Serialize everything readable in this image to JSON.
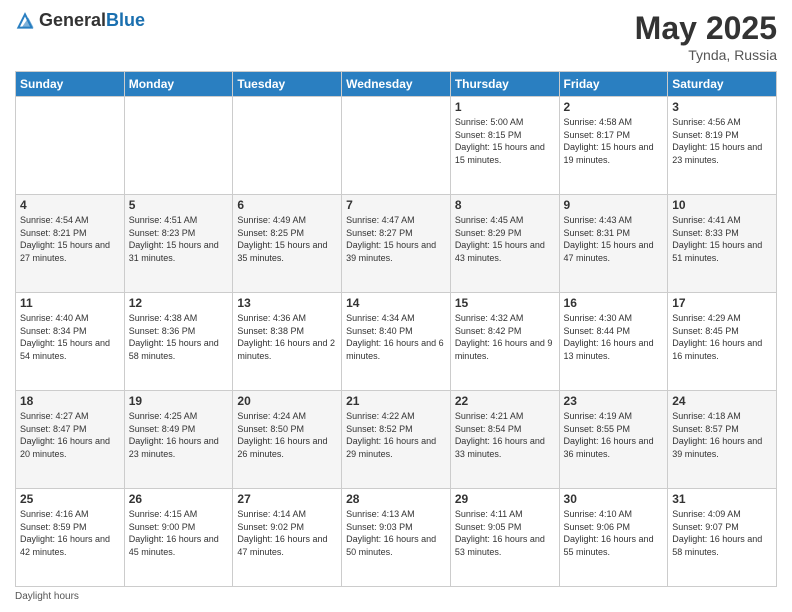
{
  "header": {
    "logo_general": "General",
    "logo_blue": "Blue",
    "month_year": "May 2025",
    "location": "Tynda, Russia"
  },
  "days_of_week": [
    "Sunday",
    "Monday",
    "Tuesday",
    "Wednesday",
    "Thursday",
    "Friday",
    "Saturday"
  ],
  "weeks": [
    [
      {
        "day": "",
        "sunrise": "",
        "sunset": "",
        "daylight": ""
      },
      {
        "day": "",
        "sunrise": "",
        "sunset": "",
        "daylight": ""
      },
      {
        "day": "",
        "sunrise": "",
        "sunset": "",
        "daylight": ""
      },
      {
        "day": "",
        "sunrise": "",
        "sunset": "",
        "daylight": ""
      },
      {
        "day": "1",
        "sunrise": "Sunrise: 5:00 AM",
        "sunset": "Sunset: 8:15 PM",
        "daylight": "Daylight: 15 hours and 15 minutes."
      },
      {
        "day": "2",
        "sunrise": "Sunrise: 4:58 AM",
        "sunset": "Sunset: 8:17 PM",
        "daylight": "Daylight: 15 hours and 19 minutes."
      },
      {
        "day": "3",
        "sunrise": "Sunrise: 4:56 AM",
        "sunset": "Sunset: 8:19 PM",
        "daylight": "Daylight: 15 hours and 23 minutes."
      }
    ],
    [
      {
        "day": "4",
        "sunrise": "Sunrise: 4:54 AM",
        "sunset": "Sunset: 8:21 PM",
        "daylight": "Daylight: 15 hours and 27 minutes."
      },
      {
        "day": "5",
        "sunrise": "Sunrise: 4:51 AM",
        "sunset": "Sunset: 8:23 PM",
        "daylight": "Daylight: 15 hours and 31 minutes."
      },
      {
        "day": "6",
        "sunrise": "Sunrise: 4:49 AM",
        "sunset": "Sunset: 8:25 PM",
        "daylight": "Daylight: 15 hours and 35 minutes."
      },
      {
        "day": "7",
        "sunrise": "Sunrise: 4:47 AM",
        "sunset": "Sunset: 8:27 PM",
        "daylight": "Daylight: 15 hours and 39 minutes."
      },
      {
        "day": "8",
        "sunrise": "Sunrise: 4:45 AM",
        "sunset": "Sunset: 8:29 PM",
        "daylight": "Daylight: 15 hours and 43 minutes."
      },
      {
        "day": "9",
        "sunrise": "Sunrise: 4:43 AM",
        "sunset": "Sunset: 8:31 PM",
        "daylight": "Daylight: 15 hours and 47 minutes."
      },
      {
        "day": "10",
        "sunrise": "Sunrise: 4:41 AM",
        "sunset": "Sunset: 8:33 PM",
        "daylight": "Daylight: 15 hours and 51 minutes."
      }
    ],
    [
      {
        "day": "11",
        "sunrise": "Sunrise: 4:40 AM",
        "sunset": "Sunset: 8:34 PM",
        "daylight": "Daylight: 15 hours and 54 minutes."
      },
      {
        "day": "12",
        "sunrise": "Sunrise: 4:38 AM",
        "sunset": "Sunset: 8:36 PM",
        "daylight": "Daylight: 15 hours and 58 minutes."
      },
      {
        "day": "13",
        "sunrise": "Sunrise: 4:36 AM",
        "sunset": "Sunset: 8:38 PM",
        "daylight": "Daylight: 16 hours and 2 minutes."
      },
      {
        "day": "14",
        "sunrise": "Sunrise: 4:34 AM",
        "sunset": "Sunset: 8:40 PM",
        "daylight": "Daylight: 16 hours and 6 minutes."
      },
      {
        "day": "15",
        "sunrise": "Sunrise: 4:32 AM",
        "sunset": "Sunset: 8:42 PM",
        "daylight": "Daylight: 16 hours and 9 minutes."
      },
      {
        "day": "16",
        "sunrise": "Sunrise: 4:30 AM",
        "sunset": "Sunset: 8:44 PM",
        "daylight": "Daylight: 16 hours and 13 minutes."
      },
      {
        "day": "17",
        "sunrise": "Sunrise: 4:29 AM",
        "sunset": "Sunset: 8:45 PM",
        "daylight": "Daylight: 16 hours and 16 minutes."
      }
    ],
    [
      {
        "day": "18",
        "sunrise": "Sunrise: 4:27 AM",
        "sunset": "Sunset: 8:47 PM",
        "daylight": "Daylight: 16 hours and 20 minutes."
      },
      {
        "day": "19",
        "sunrise": "Sunrise: 4:25 AM",
        "sunset": "Sunset: 8:49 PM",
        "daylight": "Daylight: 16 hours and 23 minutes."
      },
      {
        "day": "20",
        "sunrise": "Sunrise: 4:24 AM",
        "sunset": "Sunset: 8:50 PM",
        "daylight": "Daylight: 16 hours and 26 minutes."
      },
      {
        "day": "21",
        "sunrise": "Sunrise: 4:22 AM",
        "sunset": "Sunset: 8:52 PM",
        "daylight": "Daylight: 16 hours and 29 minutes."
      },
      {
        "day": "22",
        "sunrise": "Sunrise: 4:21 AM",
        "sunset": "Sunset: 8:54 PM",
        "daylight": "Daylight: 16 hours and 33 minutes."
      },
      {
        "day": "23",
        "sunrise": "Sunrise: 4:19 AM",
        "sunset": "Sunset: 8:55 PM",
        "daylight": "Daylight: 16 hours and 36 minutes."
      },
      {
        "day": "24",
        "sunrise": "Sunrise: 4:18 AM",
        "sunset": "Sunset: 8:57 PM",
        "daylight": "Daylight: 16 hours and 39 minutes."
      }
    ],
    [
      {
        "day": "25",
        "sunrise": "Sunrise: 4:16 AM",
        "sunset": "Sunset: 8:59 PM",
        "daylight": "Daylight: 16 hours and 42 minutes."
      },
      {
        "day": "26",
        "sunrise": "Sunrise: 4:15 AM",
        "sunset": "Sunset: 9:00 PM",
        "daylight": "Daylight: 16 hours and 45 minutes."
      },
      {
        "day": "27",
        "sunrise": "Sunrise: 4:14 AM",
        "sunset": "Sunset: 9:02 PM",
        "daylight": "Daylight: 16 hours and 47 minutes."
      },
      {
        "day": "28",
        "sunrise": "Sunrise: 4:13 AM",
        "sunset": "Sunset: 9:03 PM",
        "daylight": "Daylight: 16 hours and 50 minutes."
      },
      {
        "day": "29",
        "sunrise": "Sunrise: 4:11 AM",
        "sunset": "Sunset: 9:05 PM",
        "daylight": "Daylight: 16 hours and 53 minutes."
      },
      {
        "day": "30",
        "sunrise": "Sunrise: 4:10 AM",
        "sunset": "Sunset: 9:06 PM",
        "daylight": "Daylight: 16 hours and 55 minutes."
      },
      {
        "day": "31",
        "sunrise": "Sunrise: 4:09 AM",
        "sunset": "Sunset: 9:07 PM",
        "daylight": "Daylight: 16 hours and 58 minutes."
      }
    ]
  ],
  "footer": {
    "daylight_hours": "Daylight hours"
  }
}
